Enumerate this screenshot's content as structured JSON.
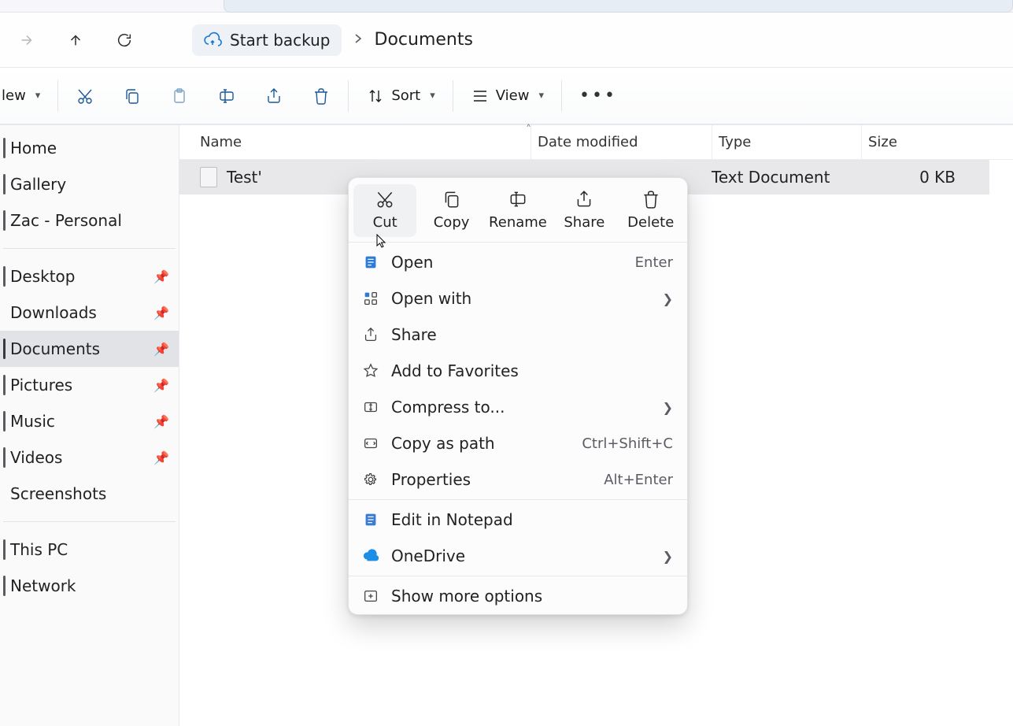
{
  "breadcrumb": {
    "backup_label": "Start backup",
    "current": "Documents"
  },
  "toolbar": {
    "new_label": "lew",
    "sort_label": "Sort",
    "view_label": "View"
  },
  "sidebar": {
    "home": "Home",
    "gallery": "Gallery",
    "personal": "Zac - Personal",
    "desktop": "Desktop",
    "downloads": "Downloads",
    "documents": "Documents",
    "pictures": "Pictures",
    "music": "Music",
    "videos": "Videos",
    "screenshots": "Screenshots",
    "thispc": "This PC",
    "network": "Network"
  },
  "columns": {
    "name": "Name",
    "date_modified": "Date modified",
    "type": "Type",
    "size": "Size"
  },
  "file": {
    "name": "Test'",
    "type": "Text Document",
    "size": "0 KB"
  },
  "context": {
    "quick": {
      "cut": "Cut",
      "copy": "Copy",
      "rename": "Rename",
      "share": "Share",
      "delete": "Delete"
    },
    "open": {
      "label": "Open",
      "accel": "Enter"
    },
    "open_with": {
      "label": "Open with"
    },
    "share": {
      "label": "Share"
    },
    "fav": {
      "label": "Add to Favorites"
    },
    "compress": {
      "label": "Compress to..."
    },
    "copy_path": {
      "label": "Copy as path",
      "accel": "Ctrl+Shift+C"
    },
    "properties": {
      "label": "Properties",
      "accel": "Alt+Enter"
    },
    "edit_notepad": {
      "label": "Edit in Notepad"
    },
    "onedrive": {
      "label": "OneDrive"
    },
    "more": {
      "label": "Show more options"
    }
  }
}
